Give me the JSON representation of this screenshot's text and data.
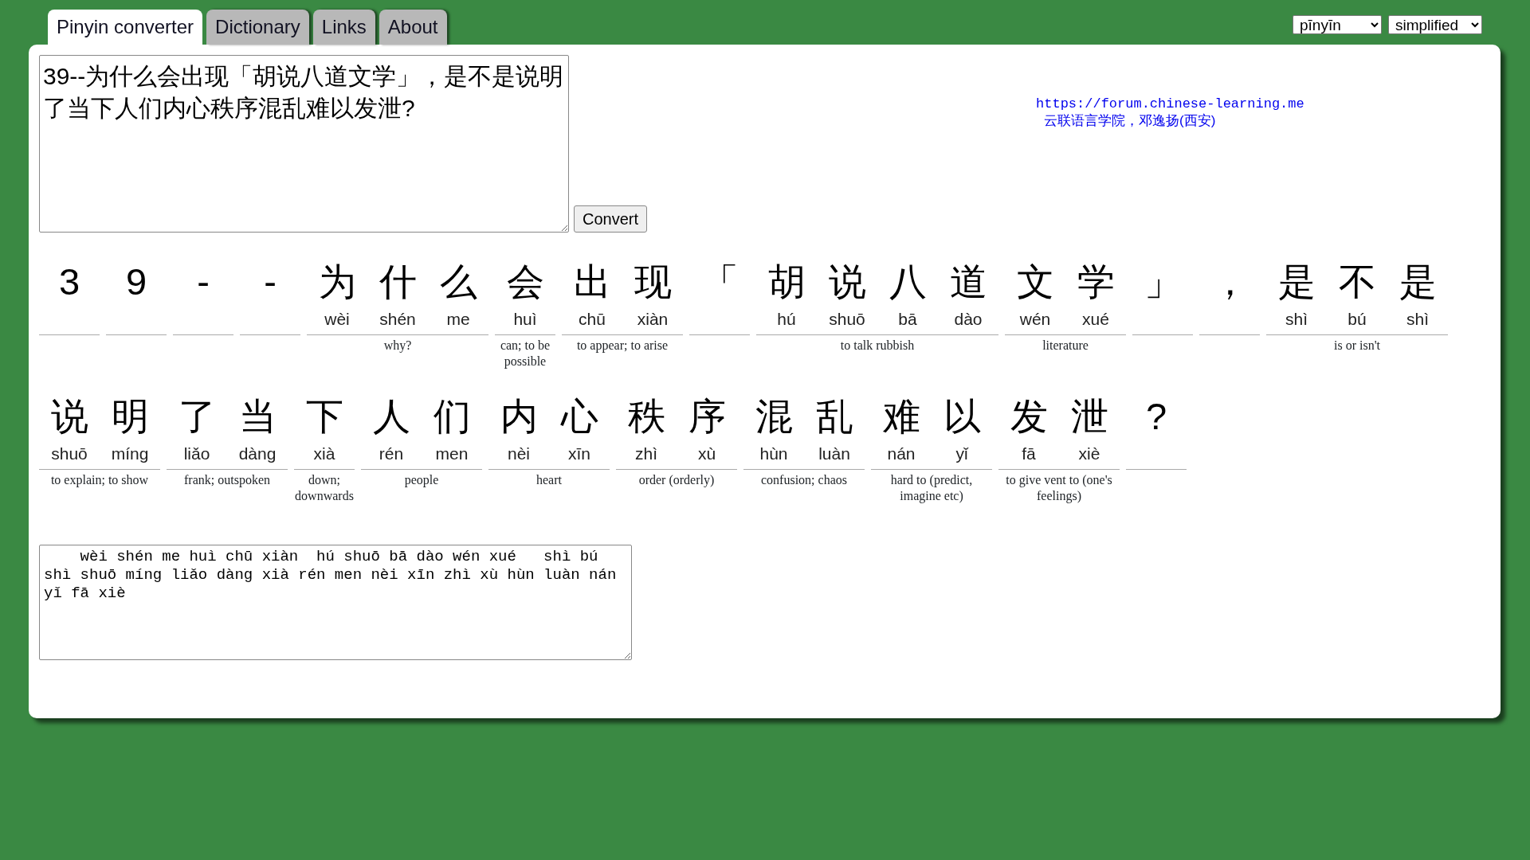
{
  "tabs": [
    {
      "label": "Pinyin converter",
      "selected": true
    },
    {
      "label": "Dictionary",
      "selected": false
    },
    {
      "label": "Links",
      "selected": false
    },
    {
      "label": "About",
      "selected": false
    }
  ],
  "selects": [
    {
      "value": "pīnyīn"
    },
    {
      "value": "simplified"
    }
  ],
  "input": {
    "value": "39--为什么会出现「胡说八道文学」，是不是说明了当下人们内心秩序混乱难以发泄?"
  },
  "convert_button": "Convert",
  "credits": {
    "url": "https://forum.chinese-learning.me",
    "name": "云联语言学院，邓逸扬(西安)"
  },
  "words": [
    {
      "chars": [
        {
          "hanzi": "3"
        }
      ]
    },
    {
      "chars": [
        {
          "hanzi": "9"
        }
      ]
    },
    {
      "chars": [
        {
          "hanzi": "-"
        }
      ]
    },
    {
      "chars": [
        {
          "hanzi": "-"
        }
      ]
    },
    {
      "chars": [
        {
          "hanzi": "为",
          "pinyin": "wèi"
        },
        {
          "hanzi": "什",
          "pinyin": "shén"
        },
        {
          "hanzi": "么",
          "pinyin": "me"
        }
      ],
      "gloss": "why?"
    },
    {
      "chars": [
        {
          "hanzi": "会",
          "pinyin": "huì"
        }
      ],
      "gloss": "can; to be possible"
    },
    {
      "chars": [
        {
          "hanzi": "出",
          "pinyin": "chū"
        },
        {
          "hanzi": "现",
          "pinyin": "xiàn"
        }
      ],
      "gloss": "to appear; to arise"
    },
    {
      "chars": [
        {
          "hanzi": "「"
        }
      ]
    },
    {
      "chars": [
        {
          "hanzi": "胡",
          "pinyin": "hú"
        },
        {
          "hanzi": "说",
          "pinyin": "shuō"
        },
        {
          "hanzi": "八",
          "pinyin": "bā"
        },
        {
          "hanzi": "道",
          "pinyin": "dào"
        }
      ],
      "gloss": "to talk rubbish"
    },
    {
      "chars": [
        {
          "hanzi": "文",
          "pinyin": "wén"
        },
        {
          "hanzi": "学",
          "pinyin": "xué"
        }
      ],
      "gloss": "literature"
    },
    {
      "chars": [
        {
          "hanzi": "」"
        }
      ]
    },
    {
      "chars": [
        {
          "hanzi": "，"
        }
      ]
    },
    {
      "chars": [
        {
          "hanzi": "是",
          "pinyin": "shì"
        },
        {
          "hanzi": "不",
          "pinyin": "bú"
        },
        {
          "hanzi": "是",
          "pinyin": "shì"
        }
      ],
      "gloss": "is or isn't"
    },
    {
      "chars": [
        {
          "hanzi": "说",
          "pinyin": "shuō"
        },
        {
          "hanzi": "明",
          "pinyin": "míng"
        }
      ],
      "gloss": "to explain; to show"
    },
    {
      "chars": [
        {
          "hanzi": "了",
          "pinyin": "liǎo"
        },
        {
          "hanzi": "当",
          "pinyin": "dàng"
        }
      ],
      "gloss": "frank; outspoken"
    },
    {
      "chars": [
        {
          "hanzi": "下",
          "pinyin": "xià"
        }
      ],
      "gloss": "down; downwards"
    },
    {
      "chars": [
        {
          "hanzi": "人",
          "pinyin": "rén"
        },
        {
          "hanzi": "们",
          "pinyin": "men"
        }
      ],
      "gloss": "people"
    },
    {
      "chars": [
        {
          "hanzi": "内",
          "pinyin": "nèi"
        },
        {
          "hanzi": "心",
          "pinyin": "xīn"
        }
      ],
      "gloss": "heart"
    },
    {
      "chars": [
        {
          "hanzi": "秩",
          "pinyin": "zhì"
        },
        {
          "hanzi": "序",
          "pinyin": "xù"
        }
      ],
      "gloss": "order (orderly)"
    },
    {
      "chars": [
        {
          "hanzi": "混",
          "pinyin": "hùn"
        },
        {
          "hanzi": "乱",
          "pinyin": "luàn"
        }
      ],
      "gloss": "confusion; chaos"
    },
    {
      "chars": [
        {
          "hanzi": "难",
          "pinyin": "nán"
        },
        {
          "hanzi": "以",
          "pinyin": "yǐ"
        }
      ],
      "gloss": "hard to (predict, imagine etc)"
    },
    {
      "chars": [
        {
          "hanzi": "发",
          "pinyin": "fā"
        },
        {
          "hanzi": "泄",
          "pinyin": "xiè"
        }
      ],
      "gloss": "to give vent to (one's feelings)"
    },
    {
      "chars": [
        {
          "hanzi": "?"
        }
      ]
    }
  ],
  "output": {
    "value": "    wèi shén me huì chū xiàn  hú shuō bā dào wén xué   shì bú shì shuō míng liǎo dàng xià rén men nèi xīn zhì xù hùn luàn nán yǐ fā xiè"
  }
}
